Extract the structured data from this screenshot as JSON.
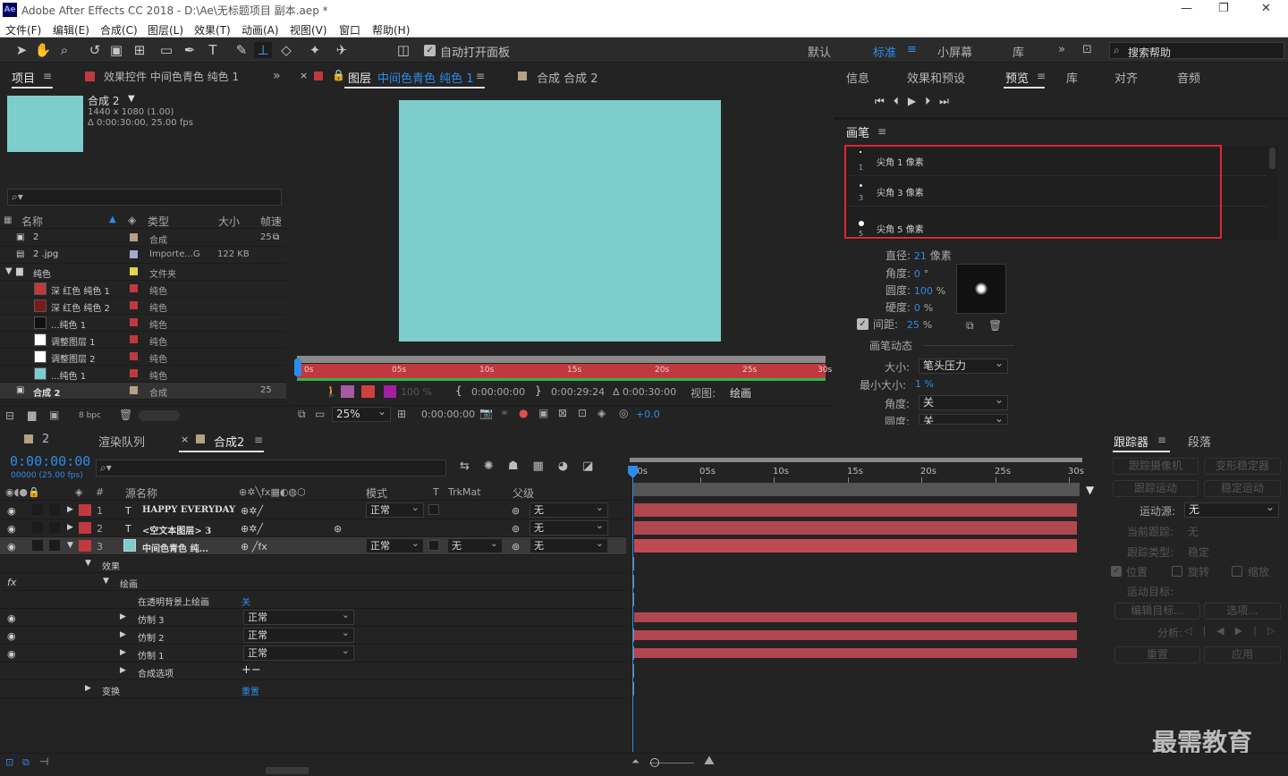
{
  "window": {
    "title": "Adobe After Effects CC 2018 - D:\\Ae\\无标题项目 副本.aep *",
    "logo": "Ae"
  },
  "menu": [
    "文件(F)",
    "编辑(E)",
    "合成(C)",
    "图层(L)",
    "效果(T)",
    "动画(A)",
    "视图(V)",
    "窗口",
    "帮助(H)"
  ],
  "toolbar": {
    "auto_open": "自动打开面板",
    "workspaces": [
      "默认",
      "标准",
      "小屏幕",
      "库"
    ],
    "active_ws": "标准",
    "search": "搜索帮助"
  },
  "project": {
    "tab": "项目",
    "effects_tab": "效果控件 中间色青色 纯色 1",
    "comp_name": "合成 2",
    "comp_size": "1440 x 1080 (1.00)",
    "comp_duration": "Δ 0:00:30:00, 25.00 fps",
    "cols": {
      "name": "名称",
      "type": "类型",
      "size": "大小",
      "fps": "帧速"
    },
    "items": [
      {
        "name": "2",
        "type": "合成",
        "size": "",
        "fps": "25",
        "color": "#b5a282"
      },
      {
        "name": "2 .jpg",
        "type": "Importe...G",
        "size": "122 KB",
        "fps": "",
        "color": "#a6a9d1"
      },
      {
        "name": "纯色",
        "type": "文件夹",
        "size": "",
        "fps": "",
        "color": "#e3d64a"
      },
      {
        "name": "深 红色 纯色 1",
        "type": "纯色",
        "size": "",
        "fps": "",
        "color": "#c0393f"
      },
      {
        "name": "深 红色 纯色 2",
        "type": "纯色",
        "size": "",
        "fps": "",
        "color": "#c0393f"
      },
      {
        "name": "...纯色 1",
        "type": "纯色",
        "size": "",
        "fps": "",
        "color": "#c0393f"
      },
      {
        "name": "调整图层 1",
        "type": "纯色",
        "size": "",
        "fps": "",
        "color": "#c0393f"
      },
      {
        "name": "调整图层 2",
        "type": "纯色",
        "size": "",
        "fps": "",
        "color": "#c0393f"
      },
      {
        "name": "...纯色 1",
        "type": "纯色",
        "size": "",
        "fps": "",
        "color": "#c0393f"
      },
      {
        "name": "合成 2",
        "type": "合成",
        "size": "",
        "fps": "25",
        "color": "#b5a282"
      }
    ],
    "bpc": "8 bpc"
  },
  "viewer": {
    "layer_tab": "图层",
    "layer_name": "中间色青色 纯色 1",
    "comp_tab": "合成 合成 2",
    "ruler": [
      "0s",
      "05s",
      "10s",
      "15s",
      "20s",
      "25s",
      "30s"
    ],
    "opacity": "100 %",
    "tin": "0:00:00:00",
    "tout": "0:00:29:24",
    "tdur": "Δ 0:00:30:00",
    "view_label": "视图:",
    "view_val": "绘画",
    "zoom": "25%",
    "time": "0:00:00:00",
    "exposure": "+0.0"
  },
  "right": {
    "tabs": [
      "信息",
      "效果和预设",
      "预览",
      "库",
      "对齐",
      "音频"
    ],
    "brush_title": "画笔",
    "brushes": [
      {
        "num": "1",
        "name": "尖角 1 像素"
      },
      {
        "num": "3",
        "name": "尖角 3 像素"
      },
      {
        "num": "5",
        "name": "尖角 5 像素"
      }
    ],
    "diameter_l": "直径:",
    "diameter_v": "21",
    "diameter_u": "像素",
    "angle_l": "角度:",
    "angle_v": "0",
    "angle_u": "°",
    "round_l": "圆度:",
    "round_v": "100",
    "round_u": "%",
    "hard_l": "硬度:",
    "hard_v": "0",
    "hard_u": "%",
    "spacing_l": "间距:",
    "spacing_v": "25",
    "spacing_u": "%",
    "dyn": "画笔动态",
    "size_l": "大小:",
    "size_v": "笔头压力",
    "minsize_l": "最小大小:",
    "minsize_v": "1 %",
    "angle2_l": "角度:",
    "angle2_v": "关",
    "round2_l": "圆度:",
    "round2_v": "关"
  },
  "timeline": {
    "tabs": [
      "2",
      "渲染队列",
      "合成2"
    ],
    "timecode": "0:00:00:00",
    "fps": "00000 (25.00 fps)",
    "cols": {
      "name": "源名称",
      "mode": "模式",
      "t": "T",
      "trk": "TrkMat",
      "parent": "父级"
    },
    "ruler": [
      "00s",
      "05s",
      "10s",
      "15s",
      "20s",
      "25s",
      "30s"
    ],
    "layers": [
      {
        "num": "1",
        "name": "HAPPY EVERYDAY",
        "mode": "正常",
        "trk": "",
        "parent": "无"
      },
      {
        "num": "2",
        "name": "<空文本图层> 3",
        "mode": "",
        "trk": "",
        "parent": "无"
      },
      {
        "num": "3",
        "name": "中间色青色 纯...",
        "mode": "正常",
        "trk": "无",
        "parent": "无"
      }
    ],
    "sub": {
      "effects": "效果",
      "paint": "绘画",
      "on_trans": "在透明背景上绘画",
      "on_trans_v": "关",
      "clones": [
        {
          "name": "仿制 3",
          "mode": "正常"
        },
        {
          "name": "仿制 2",
          "mode": "正常"
        },
        {
          "name": "仿制 1",
          "mode": "正常"
        }
      ],
      "comp_opts": "合成选项",
      "transform": "变换",
      "reset": "重置"
    }
  },
  "tracker": {
    "tabs": [
      "跟踪器",
      "段落"
    ],
    "btn1": "跟踪摄像机",
    "btn2": "变形稳定器",
    "btn3": "跟踪运动",
    "btn4": "稳定运动",
    "src_l": "运动源:",
    "src_v": "无",
    "cur_l": "当前跟踪:",
    "cur_v": "无",
    "type_l": "跟踪类型:",
    "type_v": "稳定",
    "pos": "位置",
    "rot": "旋转",
    "scale": "缩放",
    "target_l": "运动目标:",
    "edit": "编辑目标...",
    "opts": "选项...",
    "analyze": "分析:",
    "reset": "重置",
    "apply": "应用"
  },
  "watermark": "最需教育"
}
